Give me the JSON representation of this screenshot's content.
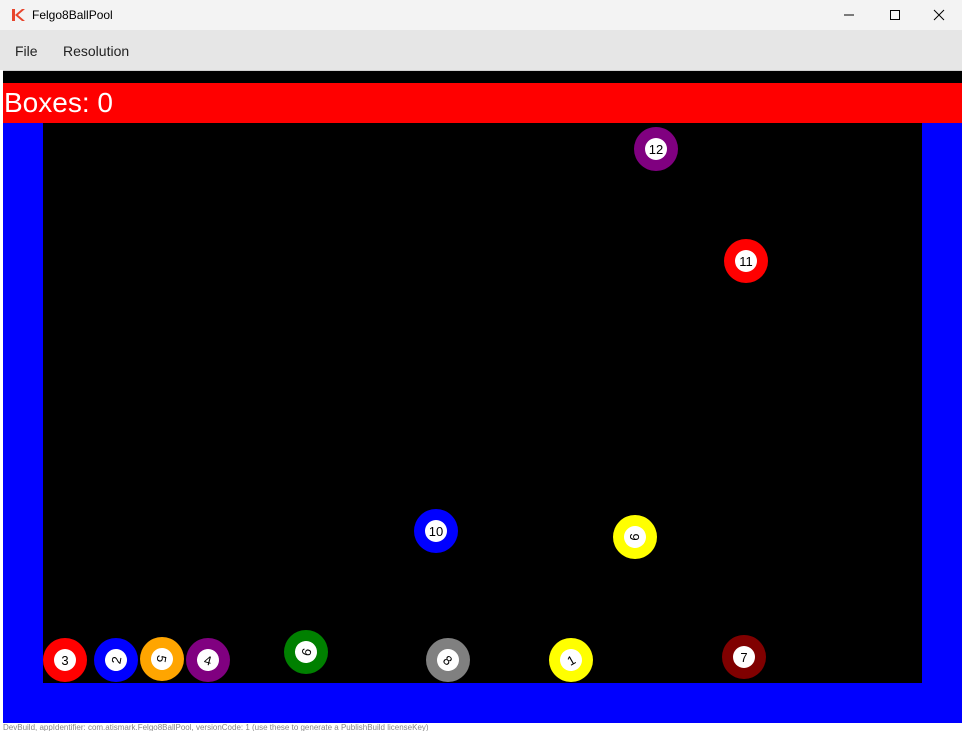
{
  "window": {
    "title": "Felgo8BallPool",
    "controls": [
      "minimize-icon",
      "maximize-icon",
      "close-icon"
    ]
  },
  "menu": {
    "items": [
      {
        "label": "File"
      },
      {
        "label": "Resolution"
      }
    ]
  },
  "hud": {
    "label": "Boxes: 0"
  },
  "colors": {
    "hud": "#ff0000",
    "walls": "#0000ff",
    "table": "#000000"
  },
  "balls": [
    {
      "number": "12",
      "color": "#800080"
    },
    {
      "number": "11",
      "color": "#ff0000"
    },
    {
      "number": "10",
      "color": "#0000ff"
    },
    {
      "number": "9",
      "color": "#ffff00"
    },
    {
      "number": "3",
      "color": "#ff0000"
    },
    {
      "number": "2",
      "color": "#0000ff"
    },
    {
      "number": "5",
      "color": "#ffa500"
    },
    {
      "number": "4",
      "color": "#800080"
    },
    {
      "number": "6",
      "color": "#008000"
    },
    {
      "number": "8",
      "color": "#808080"
    },
    {
      "number": "1",
      "color": "#ffff00"
    },
    {
      "number": "7",
      "color": "#800000"
    }
  ],
  "footer": {
    "text": "DevBuild, appIdentifier: com.atismark.Felgo8BallPool, versionCode: 1 (use these to generate a PublishBuild licenseKey)"
  }
}
